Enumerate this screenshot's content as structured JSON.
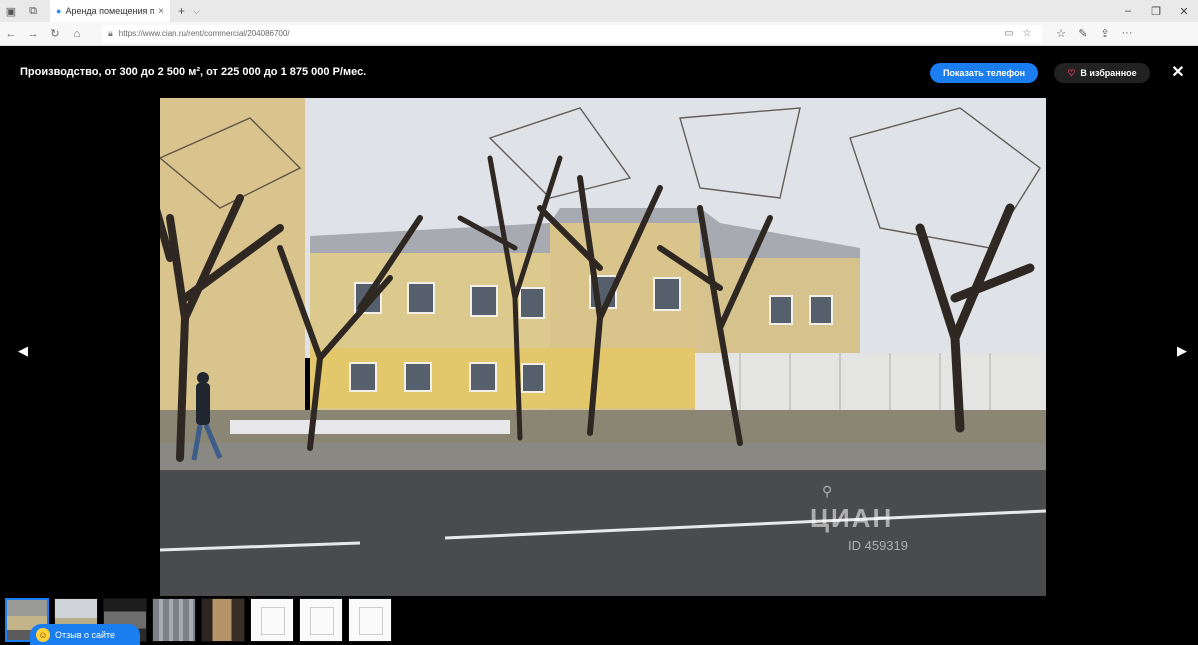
{
  "browser": {
    "tab_title": "Аренда помещения пс",
    "tab_close": "×",
    "new_tab": "+",
    "tab_dropdown": "⌵",
    "window_controls": {
      "minimize": "–",
      "restore": "❐",
      "close": "✕"
    },
    "nav": {
      "back": "←",
      "forward": "→",
      "refresh": "↻",
      "home": "⌂"
    },
    "url": "https://www.cian.ru/rent/commercial/204086700/",
    "url_icons": {
      "reading": "▭",
      "favorite": "☆"
    },
    "tools": {
      "favorites": "☆",
      "notes": "✎",
      "share": "⇪",
      "more": "···"
    }
  },
  "gallery": {
    "title": "Производство, от 300 до 2 500 м², от 225 000 до 1 875 000 Р/мес.",
    "show_phone_label": "Показать телефон",
    "favorite_label": "В избранное",
    "favorite_icon": "♡",
    "close_label": "✕",
    "prev_arrow": "◀",
    "next_arrow": "▶"
  },
  "photo": {
    "watermark_logo": "ЦИАН",
    "watermark_id": "ID 459319",
    "watermark_pin": "⚲"
  },
  "thumbnails": {
    "count": 8,
    "active_index": 0
  },
  "feedback": {
    "label": "Отзыв о сайте",
    "icon": "☺"
  }
}
